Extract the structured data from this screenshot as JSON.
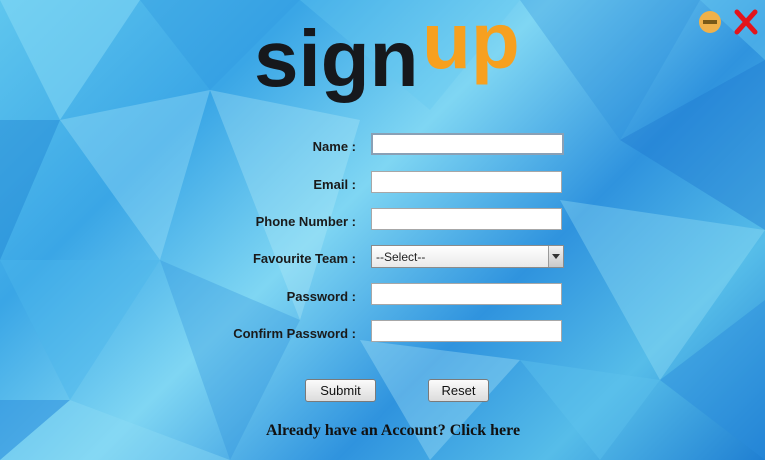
{
  "window": {
    "minimize_icon": "minimize-icon",
    "close_icon": "close-icon"
  },
  "logo": {
    "text_dark": "sign",
    "text_accent": "up",
    "accent_color": "#f7a01f",
    "dark_color": "#16181c"
  },
  "form": {
    "name_label": "Name :",
    "email_label": "Email :",
    "phone_label": "Phone Number :",
    "team_label": "Favourite Team :",
    "password_label": "Password :",
    "confirm_password_label": "Confirm Password :",
    "name_value": "",
    "email_value": "",
    "phone_value": "",
    "team_selected": "--Select--",
    "password_value": "",
    "confirm_password_value": ""
  },
  "buttons": {
    "submit_label": "Submit",
    "reset_label": "Reset"
  },
  "footer": {
    "account_link": "Already have an Account? Click here"
  },
  "colors": {
    "background": "#3aa6e6",
    "minimize": "#f0b14a",
    "close": "#e3141b"
  }
}
